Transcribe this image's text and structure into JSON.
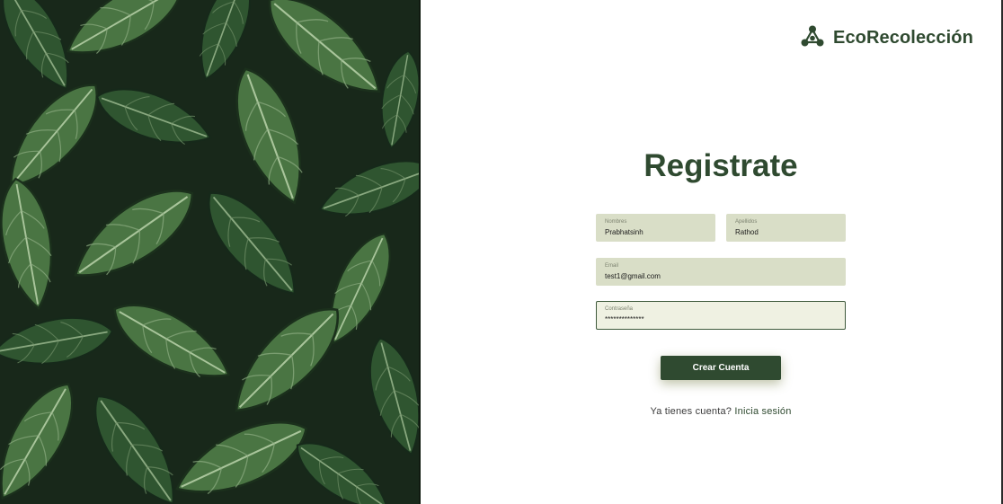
{
  "brand": {
    "name": "EcoRecolección",
    "icon": "recycle-nodes-icon",
    "color": "#2f4a30"
  },
  "hero": {
    "image": "green-hosta-leaves-photo"
  },
  "form": {
    "title": "Registrate",
    "fields": {
      "nombres": {
        "label": "Nombres",
        "value": "Prabhatsinh"
      },
      "apellidos": {
        "label": "Apellidos",
        "value": "Rathod"
      },
      "email": {
        "label": "Email",
        "value": "test1@gmail.com"
      },
      "password": {
        "label": "Contraseña",
        "value": "**************"
      }
    },
    "submit_label": "Crear Cuenta",
    "signin_prompt": "Ya tienes cuenta?",
    "signin_link": "Inicia sesión"
  },
  "colors": {
    "accent": "#2f4a30",
    "field_bg": "#d9dec7",
    "field_focus_bg": "#eff1e2"
  }
}
